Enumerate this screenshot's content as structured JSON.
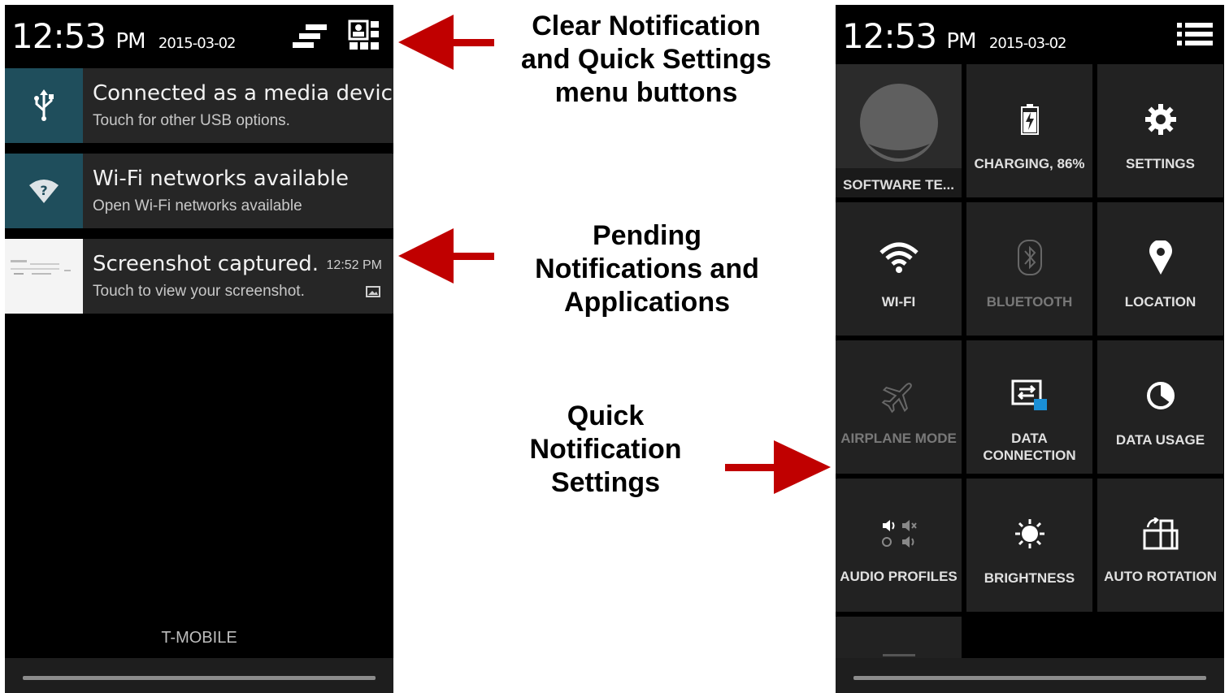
{
  "left_panel": {
    "status": {
      "time": "12:53",
      "ampm": "PM",
      "date": "2015-03-02"
    },
    "notifications": [
      {
        "title": "Connected as a media device",
        "subtitle": "Touch for other USB options.",
        "icon": "usb-icon"
      },
      {
        "title": "Wi-Fi networks available",
        "subtitle": "Open Wi-Fi networks available",
        "icon": "wifi-question-icon"
      },
      {
        "title": "Screenshot captured.",
        "subtitle": "Touch to view your screenshot.",
        "time": "12:52 PM",
        "icon": "screenshot-thumbnail"
      }
    ],
    "carrier": "T-MOBILE"
  },
  "right_panel": {
    "status": {
      "time": "12:53",
      "ampm": "PM",
      "date": "2015-03-02"
    },
    "tiles": [
      {
        "label": "SOFTWARE TE...",
        "icon": "user-avatar-icon"
      },
      {
        "label": "CHARGING, 86%",
        "icon": "battery-charging-icon",
        "level": 0.86
      },
      {
        "label": "SETTINGS",
        "icon": "gear-icon"
      },
      {
        "label": "WI-FI",
        "icon": "wifi-icon"
      },
      {
        "label": "BLUETOOTH",
        "icon": "bluetooth-icon"
      },
      {
        "label": "LOCATION",
        "icon": "location-pin-icon"
      },
      {
        "label": "AIRPLANE MODE",
        "icon": "airplane-icon"
      },
      {
        "label": "DATA CONNECTION",
        "icon": "data-connection-icon"
      },
      {
        "label": "DATA USAGE",
        "icon": "data-usage-icon"
      },
      {
        "label": "AUDIO PROFILES",
        "icon": "audio-profiles-icon"
      },
      {
        "label": "BRIGHTNESS",
        "icon": "brightness-icon"
      },
      {
        "label": "AUTO ROTATION",
        "icon": "auto-rotation-icon"
      }
    ]
  },
  "annotations": {
    "clear": "Clear Notification and Quick Settings menu buttons",
    "pending": "Pending Notifications and Applications",
    "quick": "Quick Notification Settings"
  },
  "colors": {
    "arrow": "#c00000",
    "tile": "#222222",
    "icon_box": "#1f4e5c"
  }
}
